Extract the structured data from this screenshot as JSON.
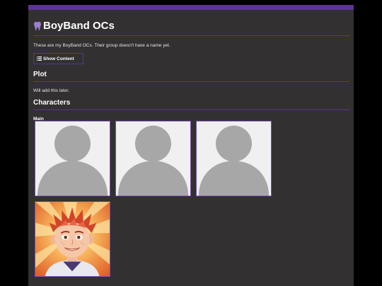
{
  "page": {
    "title": "BoyBand OCs",
    "title_icon": "tooth-icon",
    "description": "These are my BoyBand OCs. Their group doesn't have a name yet.",
    "show_button_label": "Show Content",
    "show_button_icon": "list-icon"
  },
  "plot": {
    "heading": "Plot",
    "text": "Will add this later."
  },
  "characters": {
    "heading": "Characters",
    "group_label": "Main",
    "cards": [
      {
        "image": "placeholder-avatar"
      },
      {
        "image": "placeholder-avatar"
      },
      {
        "image": "placeholder-avatar"
      },
      {
        "image": "red-haired-boy-portrait"
      }
    ]
  },
  "colors": {
    "accent": "#5c3594",
    "background": "#323031",
    "card_border": "#7a4fb3"
  }
}
